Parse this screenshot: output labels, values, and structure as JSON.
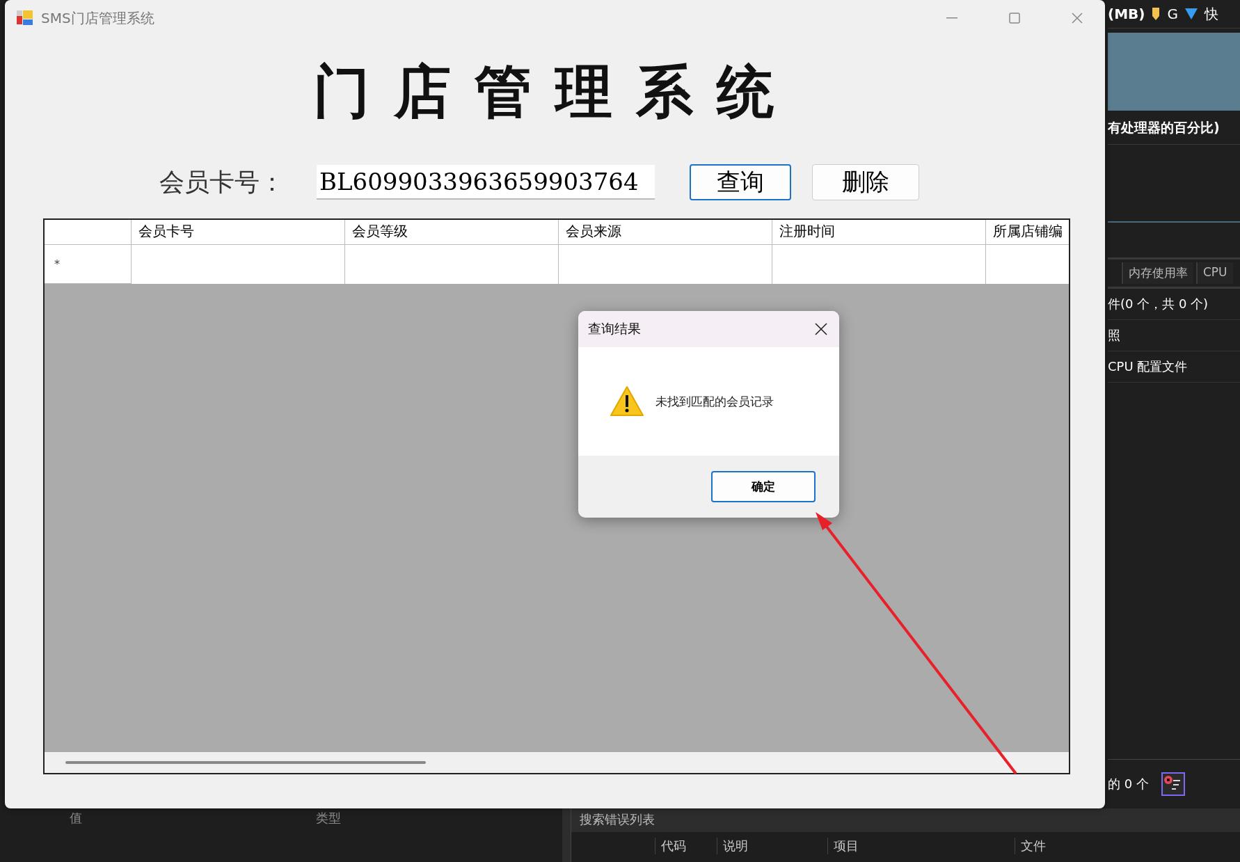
{
  "background": {
    "top_bar": {
      "heading": "(MB)",
      "letter_g": "G",
      "letter_kuai": "快"
    },
    "chart_caption": "有处理器的百分比)",
    "tabs": [
      {
        "label": "内存使用率",
        "selected": false
      },
      {
        "label": "CPU",
        "selected": false
      }
    ],
    "list_items": [
      "件(0 个，共 0 个)",
      "照",
      "CPU 配置文件"
    ],
    "filter_count": "的 0 个",
    "properties_columns": [
      "值",
      "类型"
    ],
    "error_list": {
      "title": "搜索错误列表",
      "columns": [
        "代码",
        "说明",
        "项目",
        "文件"
      ]
    }
  },
  "window": {
    "title": "SMS门店管理系统",
    "heading": "门店管理系统",
    "search": {
      "label": "会员卡号：",
      "value": "BL6099033963659903764"
    },
    "buttons": [
      {
        "label": "查询",
        "focused": true
      },
      {
        "label": "删除",
        "focused": false
      }
    ],
    "grid": {
      "columns": [
        "会员卡号",
        "会员等级",
        "会员来源",
        "注册时间",
        "所属店铺编"
      ],
      "new_row_marker": "*"
    }
  },
  "dialog": {
    "title": "查询结果",
    "message": "未找到匹配的会员记录",
    "button": "确定"
  }
}
